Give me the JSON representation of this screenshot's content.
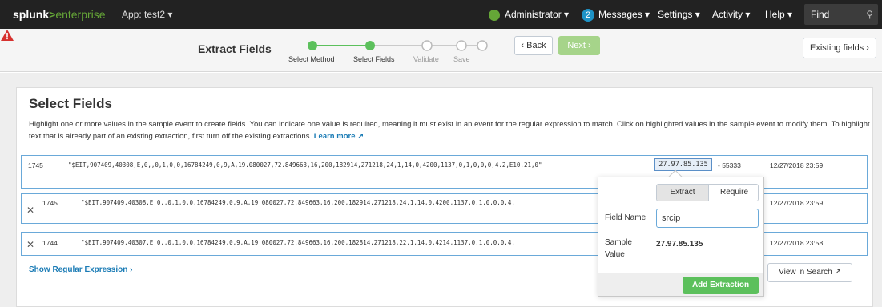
{
  "topbar": {
    "logo_splunk": "splunk",
    "logo_gt": ">",
    "logo_enterprise": "enterprise",
    "app": "App: test2 ▾",
    "administrator": "Administrator ▾",
    "messages_count": "2",
    "messages": "Messages ▾",
    "settings": "Settings ▾",
    "activity": "Activity ▾",
    "help": "Help ▾",
    "find": "Find"
  },
  "wizard": {
    "title": "Extract Fields",
    "steps": [
      "Select Method",
      "Select Fields",
      "Validate",
      "Save"
    ],
    "back": "‹ Back",
    "next": "Next ›",
    "existing": "Existing fields ›"
  },
  "main": {
    "title": "Select Fields",
    "description": "Highlight one or more values in the sample event to create fields. You can indicate one value is required, meaning it must exist in an event for the regular expression to match. Click on highlighted values in the sample event to modify them. To highlight text that is already part of an existing extraction, first turn off the existing extractions.",
    "learn_more": "Learn more ↗",
    "sample": {
      "num": "1745",
      "text": "\"$EIT,907409,40308,E,0,,0,1,0,0,16784249,0,9,A,19.080027,72.849663,16,200,182914,271218,24,1,14,0,4200,1137,0,1,0,0,0,4.2,E10.21,0\"",
      "ip": "27.97.85.135",
      "port": "- 55333",
      "time": "12/27/2018 23:59"
    },
    "events": [
      {
        "num": "1745",
        "text": "\"$EIT,907409,40308,E,0,,0,1,0,0,16784249,0,9,A,19.080027,72.849663,16,200,182914,271218,24,1,14,0,4200,1137,0,1,0,0,0,4.",
        "time": "12/27/2018 23:59"
      },
      {
        "num": "1744",
        "text": "\"$EIT,907409,40307,E,0,,0,1,0,0,16784249,0,9,A,19.080027,72.849663,16,200,182814,271218,22,1,14,0,4214,1137,0,1,0,0,0,4.",
        "time": "12/27/2018 23:58"
      }
    ],
    "show_regex": "Show Regular Expression ›",
    "view_in_search": "View in Search ↗"
  },
  "popup": {
    "tab_extract": "Extract",
    "tab_require": "Require",
    "field_name_label": "Field Name",
    "field_name_value": "srcip",
    "sample_label_1": "Sample",
    "sample_label_2": "Value",
    "sample_value": "27.97.85.135",
    "add_button": "Add Extraction"
  },
  "colors": {
    "topbar_bg": "#222222",
    "brand_green": "#65a637",
    "step_active": "#5cc05c",
    "next_disabled": "#a6d48a",
    "link": "#1a7bb5",
    "warning": "#d6312e"
  }
}
